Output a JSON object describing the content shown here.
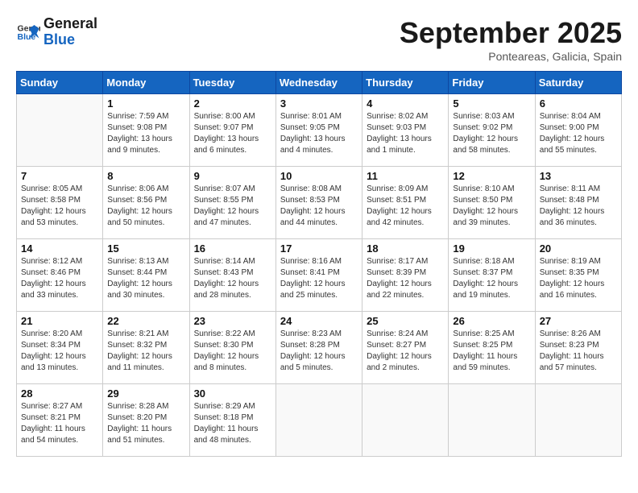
{
  "header": {
    "logo_line1": "General",
    "logo_line2": "Blue",
    "month": "September 2025",
    "location": "Ponteareas, Galicia, Spain"
  },
  "weekdays": [
    "Sunday",
    "Monday",
    "Tuesday",
    "Wednesday",
    "Thursday",
    "Friday",
    "Saturday"
  ],
  "weeks": [
    [
      {
        "day": "",
        "info": ""
      },
      {
        "day": "1",
        "info": "Sunrise: 7:59 AM\nSunset: 9:08 PM\nDaylight: 13 hours\nand 9 minutes."
      },
      {
        "day": "2",
        "info": "Sunrise: 8:00 AM\nSunset: 9:07 PM\nDaylight: 13 hours\nand 6 minutes."
      },
      {
        "day": "3",
        "info": "Sunrise: 8:01 AM\nSunset: 9:05 PM\nDaylight: 13 hours\nand 4 minutes."
      },
      {
        "day": "4",
        "info": "Sunrise: 8:02 AM\nSunset: 9:03 PM\nDaylight: 13 hours\nand 1 minute."
      },
      {
        "day": "5",
        "info": "Sunrise: 8:03 AM\nSunset: 9:02 PM\nDaylight: 12 hours\nand 58 minutes."
      },
      {
        "day": "6",
        "info": "Sunrise: 8:04 AM\nSunset: 9:00 PM\nDaylight: 12 hours\nand 55 minutes."
      }
    ],
    [
      {
        "day": "7",
        "info": "Sunrise: 8:05 AM\nSunset: 8:58 PM\nDaylight: 12 hours\nand 53 minutes."
      },
      {
        "day": "8",
        "info": "Sunrise: 8:06 AM\nSunset: 8:56 PM\nDaylight: 12 hours\nand 50 minutes."
      },
      {
        "day": "9",
        "info": "Sunrise: 8:07 AM\nSunset: 8:55 PM\nDaylight: 12 hours\nand 47 minutes."
      },
      {
        "day": "10",
        "info": "Sunrise: 8:08 AM\nSunset: 8:53 PM\nDaylight: 12 hours\nand 44 minutes."
      },
      {
        "day": "11",
        "info": "Sunrise: 8:09 AM\nSunset: 8:51 PM\nDaylight: 12 hours\nand 42 minutes."
      },
      {
        "day": "12",
        "info": "Sunrise: 8:10 AM\nSunset: 8:50 PM\nDaylight: 12 hours\nand 39 minutes."
      },
      {
        "day": "13",
        "info": "Sunrise: 8:11 AM\nSunset: 8:48 PM\nDaylight: 12 hours\nand 36 minutes."
      }
    ],
    [
      {
        "day": "14",
        "info": "Sunrise: 8:12 AM\nSunset: 8:46 PM\nDaylight: 12 hours\nand 33 minutes."
      },
      {
        "day": "15",
        "info": "Sunrise: 8:13 AM\nSunset: 8:44 PM\nDaylight: 12 hours\nand 30 minutes."
      },
      {
        "day": "16",
        "info": "Sunrise: 8:14 AM\nSunset: 8:43 PM\nDaylight: 12 hours\nand 28 minutes."
      },
      {
        "day": "17",
        "info": "Sunrise: 8:16 AM\nSunset: 8:41 PM\nDaylight: 12 hours\nand 25 minutes."
      },
      {
        "day": "18",
        "info": "Sunrise: 8:17 AM\nSunset: 8:39 PM\nDaylight: 12 hours\nand 22 minutes."
      },
      {
        "day": "19",
        "info": "Sunrise: 8:18 AM\nSunset: 8:37 PM\nDaylight: 12 hours\nand 19 minutes."
      },
      {
        "day": "20",
        "info": "Sunrise: 8:19 AM\nSunset: 8:35 PM\nDaylight: 12 hours\nand 16 minutes."
      }
    ],
    [
      {
        "day": "21",
        "info": "Sunrise: 8:20 AM\nSunset: 8:34 PM\nDaylight: 12 hours\nand 13 minutes."
      },
      {
        "day": "22",
        "info": "Sunrise: 8:21 AM\nSunset: 8:32 PM\nDaylight: 12 hours\nand 11 minutes."
      },
      {
        "day": "23",
        "info": "Sunrise: 8:22 AM\nSunset: 8:30 PM\nDaylight: 12 hours\nand 8 minutes."
      },
      {
        "day": "24",
        "info": "Sunrise: 8:23 AM\nSunset: 8:28 PM\nDaylight: 12 hours\nand 5 minutes."
      },
      {
        "day": "25",
        "info": "Sunrise: 8:24 AM\nSunset: 8:27 PM\nDaylight: 12 hours\nand 2 minutes."
      },
      {
        "day": "26",
        "info": "Sunrise: 8:25 AM\nSunset: 8:25 PM\nDaylight: 11 hours\nand 59 minutes."
      },
      {
        "day": "27",
        "info": "Sunrise: 8:26 AM\nSunset: 8:23 PM\nDaylight: 11 hours\nand 57 minutes."
      }
    ],
    [
      {
        "day": "28",
        "info": "Sunrise: 8:27 AM\nSunset: 8:21 PM\nDaylight: 11 hours\nand 54 minutes."
      },
      {
        "day": "29",
        "info": "Sunrise: 8:28 AM\nSunset: 8:20 PM\nDaylight: 11 hours\nand 51 minutes."
      },
      {
        "day": "30",
        "info": "Sunrise: 8:29 AM\nSunset: 8:18 PM\nDaylight: 11 hours\nand 48 minutes."
      },
      {
        "day": "",
        "info": ""
      },
      {
        "day": "",
        "info": ""
      },
      {
        "day": "",
        "info": ""
      },
      {
        "day": "",
        "info": ""
      }
    ]
  ]
}
